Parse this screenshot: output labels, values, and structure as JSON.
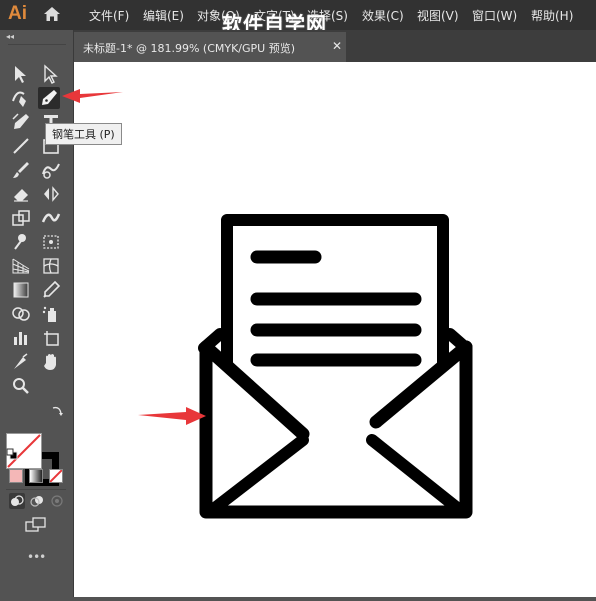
{
  "app": {
    "logo": "Ai"
  },
  "menu": [
    "文件(F)",
    "编辑(E)",
    "对象(O)",
    "文字(T)",
    "选择(S)",
    "效果(C)",
    "视图(V)",
    "窗口(W)",
    "帮助(H)"
  ],
  "watermark": "软件自学网",
  "document_tab": {
    "title": "未标题-1* @ 181.99% (CMYK/GPU 预览)",
    "close_glyph": "✕"
  },
  "tooltip": "钢笔工具 (P)",
  "toolbar": {
    "collapse_glyph": "◂◂",
    "more_glyph": "•••",
    "tools": [
      "selection",
      "direct-selection",
      "curvature",
      "pen",
      "anchor-point",
      "type",
      "line-segment",
      "rectangle",
      "paintbrush",
      "shaper",
      "eraser",
      "rotate",
      "scale",
      "width",
      "puppet-warp",
      "free-transform",
      "perspective-grid",
      "mesh",
      "gradient",
      "eyedropper",
      "shape-builder",
      "symbol-sprayer",
      "column-graph",
      "artboard",
      "slice",
      "hand",
      "zoom"
    ]
  },
  "colors": {
    "accent_orange": "#e08a3c",
    "arrow_red": "#e8373a",
    "canvas": "#ffffff",
    "toolbar": "#535353",
    "menubar": "#323232"
  }
}
